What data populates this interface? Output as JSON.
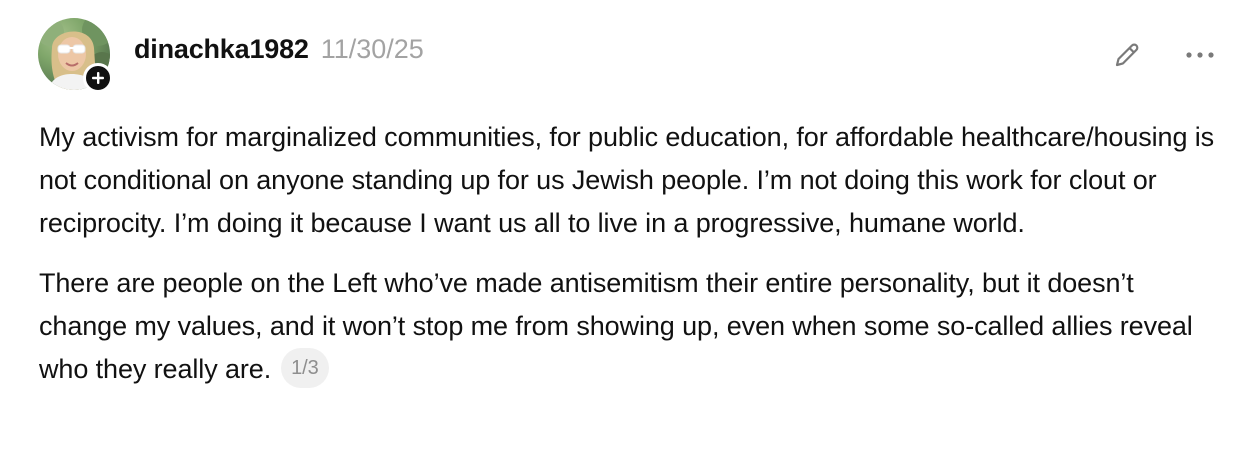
{
  "post": {
    "author": {
      "username": "dinachka1982",
      "avatar_icon": "profile-photo"
    },
    "timestamp": "11/30/25",
    "actions": {
      "follow_icon": "plus-icon",
      "edit_icon": "pencil-icon",
      "more_icon": "ellipsis-icon"
    },
    "paragraphs": [
      "My activism for marginalized communities, for public education, for affordable healthcare/housing is not conditional on anyone standing up for us Jewish people. I’m not doing this work for clout or reciprocity. I’m doing it because I want us all to live in a progressive, humane world.",
      "There are people on the Left who’ve made antisemitism their entire personality, but it doesn’t change my values, and it won’t stop me from showing up, even when some so-called allies reveal who they really are."
    ],
    "page_indicator": "1/3"
  },
  "colors": {
    "text": "#111111",
    "muted": "#a3a3a3",
    "badge_bg": "#f0f0f0",
    "follow_badge": "#111111"
  }
}
